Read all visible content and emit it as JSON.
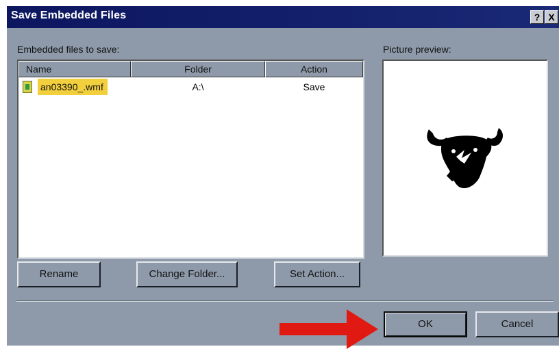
{
  "window": {
    "title": "Save Embedded Files",
    "help_label": "?",
    "close_label": "X"
  },
  "files_section": {
    "label": "Embedded files to save:",
    "columns": [
      "Name",
      "Folder",
      "Action"
    ],
    "rows": [
      {
        "name": "an03390_.wmf",
        "folder": "A:\\",
        "action": "Save"
      }
    ]
  },
  "preview": {
    "label": "Picture preview:"
  },
  "buttons": {
    "rename": "Rename",
    "change_folder": "Change Folder...",
    "set_action": "Set Action...",
    "ok": "OK",
    "cancel": "Cancel"
  },
  "colors": {
    "accent": "#0e1a5b",
    "highlight": "#f2cf3c",
    "dialog_bg": "#8e9aa9",
    "annotation_arrow": "#e01a12"
  }
}
